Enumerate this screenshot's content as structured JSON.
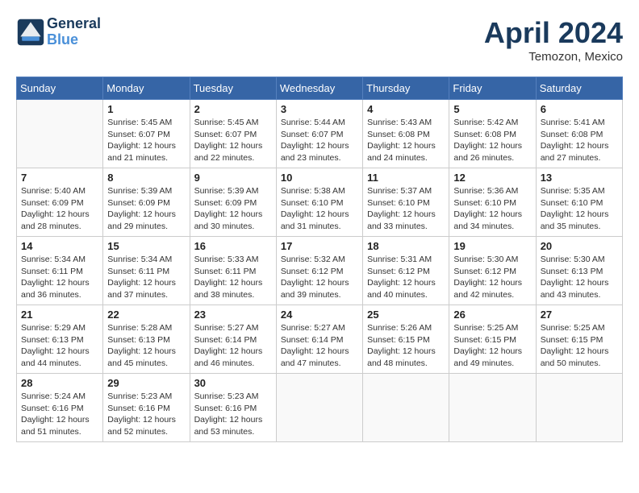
{
  "header": {
    "logo_line1": "General",
    "logo_line2": "Blue",
    "month": "April 2024",
    "location": "Temozon, Mexico"
  },
  "weekdays": [
    "Sunday",
    "Monday",
    "Tuesday",
    "Wednesday",
    "Thursday",
    "Friday",
    "Saturday"
  ],
  "weeks": [
    [
      {
        "day": "",
        "sunrise": "",
        "sunset": "",
        "daylight": ""
      },
      {
        "day": "1",
        "sunrise": "Sunrise: 5:45 AM",
        "sunset": "Sunset: 6:07 PM",
        "daylight": "Daylight: 12 hours and 21 minutes."
      },
      {
        "day": "2",
        "sunrise": "Sunrise: 5:45 AM",
        "sunset": "Sunset: 6:07 PM",
        "daylight": "Daylight: 12 hours and 22 minutes."
      },
      {
        "day": "3",
        "sunrise": "Sunrise: 5:44 AM",
        "sunset": "Sunset: 6:07 PM",
        "daylight": "Daylight: 12 hours and 23 minutes."
      },
      {
        "day": "4",
        "sunrise": "Sunrise: 5:43 AM",
        "sunset": "Sunset: 6:08 PM",
        "daylight": "Daylight: 12 hours and 24 minutes."
      },
      {
        "day": "5",
        "sunrise": "Sunrise: 5:42 AM",
        "sunset": "Sunset: 6:08 PM",
        "daylight": "Daylight: 12 hours and 26 minutes."
      },
      {
        "day": "6",
        "sunrise": "Sunrise: 5:41 AM",
        "sunset": "Sunset: 6:08 PM",
        "daylight": "Daylight: 12 hours and 27 minutes."
      }
    ],
    [
      {
        "day": "7",
        "sunrise": "Sunrise: 5:40 AM",
        "sunset": "Sunset: 6:09 PM",
        "daylight": "Daylight: 12 hours and 28 minutes."
      },
      {
        "day": "8",
        "sunrise": "Sunrise: 5:39 AM",
        "sunset": "Sunset: 6:09 PM",
        "daylight": "Daylight: 12 hours and 29 minutes."
      },
      {
        "day": "9",
        "sunrise": "Sunrise: 5:39 AM",
        "sunset": "Sunset: 6:09 PM",
        "daylight": "Daylight: 12 hours and 30 minutes."
      },
      {
        "day": "10",
        "sunrise": "Sunrise: 5:38 AM",
        "sunset": "Sunset: 6:10 PM",
        "daylight": "Daylight: 12 hours and 31 minutes."
      },
      {
        "day": "11",
        "sunrise": "Sunrise: 5:37 AM",
        "sunset": "Sunset: 6:10 PM",
        "daylight": "Daylight: 12 hours and 33 minutes."
      },
      {
        "day": "12",
        "sunrise": "Sunrise: 5:36 AM",
        "sunset": "Sunset: 6:10 PM",
        "daylight": "Daylight: 12 hours and 34 minutes."
      },
      {
        "day": "13",
        "sunrise": "Sunrise: 5:35 AM",
        "sunset": "Sunset: 6:10 PM",
        "daylight": "Daylight: 12 hours and 35 minutes."
      }
    ],
    [
      {
        "day": "14",
        "sunrise": "Sunrise: 5:34 AM",
        "sunset": "Sunset: 6:11 PM",
        "daylight": "Daylight: 12 hours and 36 minutes."
      },
      {
        "day": "15",
        "sunrise": "Sunrise: 5:34 AM",
        "sunset": "Sunset: 6:11 PM",
        "daylight": "Daylight: 12 hours and 37 minutes."
      },
      {
        "day": "16",
        "sunrise": "Sunrise: 5:33 AM",
        "sunset": "Sunset: 6:11 PM",
        "daylight": "Daylight: 12 hours and 38 minutes."
      },
      {
        "day": "17",
        "sunrise": "Sunrise: 5:32 AM",
        "sunset": "Sunset: 6:12 PM",
        "daylight": "Daylight: 12 hours and 39 minutes."
      },
      {
        "day": "18",
        "sunrise": "Sunrise: 5:31 AM",
        "sunset": "Sunset: 6:12 PM",
        "daylight": "Daylight: 12 hours and 40 minutes."
      },
      {
        "day": "19",
        "sunrise": "Sunrise: 5:30 AM",
        "sunset": "Sunset: 6:12 PM",
        "daylight": "Daylight: 12 hours and 42 minutes."
      },
      {
        "day": "20",
        "sunrise": "Sunrise: 5:30 AM",
        "sunset": "Sunset: 6:13 PM",
        "daylight": "Daylight: 12 hours and 43 minutes."
      }
    ],
    [
      {
        "day": "21",
        "sunrise": "Sunrise: 5:29 AM",
        "sunset": "Sunset: 6:13 PM",
        "daylight": "Daylight: 12 hours and 44 minutes."
      },
      {
        "day": "22",
        "sunrise": "Sunrise: 5:28 AM",
        "sunset": "Sunset: 6:13 PM",
        "daylight": "Daylight: 12 hours and 45 minutes."
      },
      {
        "day": "23",
        "sunrise": "Sunrise: 5:27 AM",
        "sunset": "Sunset: 6:14 PM",
        "daylight": "Daylight: 12 hours and 46 minutes."
      },
      {
        "day": "24",
        "sunrise": "Sunrise: 5:27 AM",
        "sunset": "Sunset: 6:14 PM",
        "daylight": "Daylight: 12 hours and 47 minutes."
      },
      {
        "day": "25",
        "sunrise": "Sunrise: 5:26 AM",
        "sunset": "Sunset: 6:15 PM",
        "daylight": "Daylight: 12 hours and 48 minutes."
      },
      {
        "day": "26",
        "sunrise": "Sunrise: 5:25 AM",
        "sunset": "Sunset: 6:15 PM",
        "daylight": "Daylight: 12 hours and 49 minutes."
      },
      {
        "day": "27",
        "sunrise": "Sunrise: 5:25 AM",
        "sunset": "Sunset: 6:15 PM",
        "daylight": "Daylight: 12 hours and 50 minutes."
      }
    ],
    [
      {
        "day": "28",
        "sunrise": "Sunrise: 5:24 AM",
        "sunset": "Sunset: 6:16 PM",
        "daylight": "Daylight: 12 hours and 51 minutes."
      },
      {
        "day": "29",
        "sunrise": "Sunrise: 5:23 AM",
        "sunset": "Sunset: 6:16 PM",
        "daylight": "Daylight: 12 hours and 52 minutes."
      },
      {
        "day": "30",
        "sunrise": "Sunrise: 5:23 AM",
        "sunset": "Sunset: 6:16 PM",
        "daylight": "Daylight: 12 hours and 53 minutes."
      },
      {
        "day": "",
        "sunrise": "",
        "sunset": "",
        "daylight": ""
      },
      {
        "day": "",
        "sunrise": "",
        "sunset": "",
        "daylight": ""
      },
      {
        "day": "",
        "sunrise": "",
        "sunset": "",
        "daylight": ""
      },
      {
        "day": "",
        "sunrise": "",
        "sunset": "",
        "daylight": ""
      }
    ]
  ]
}
